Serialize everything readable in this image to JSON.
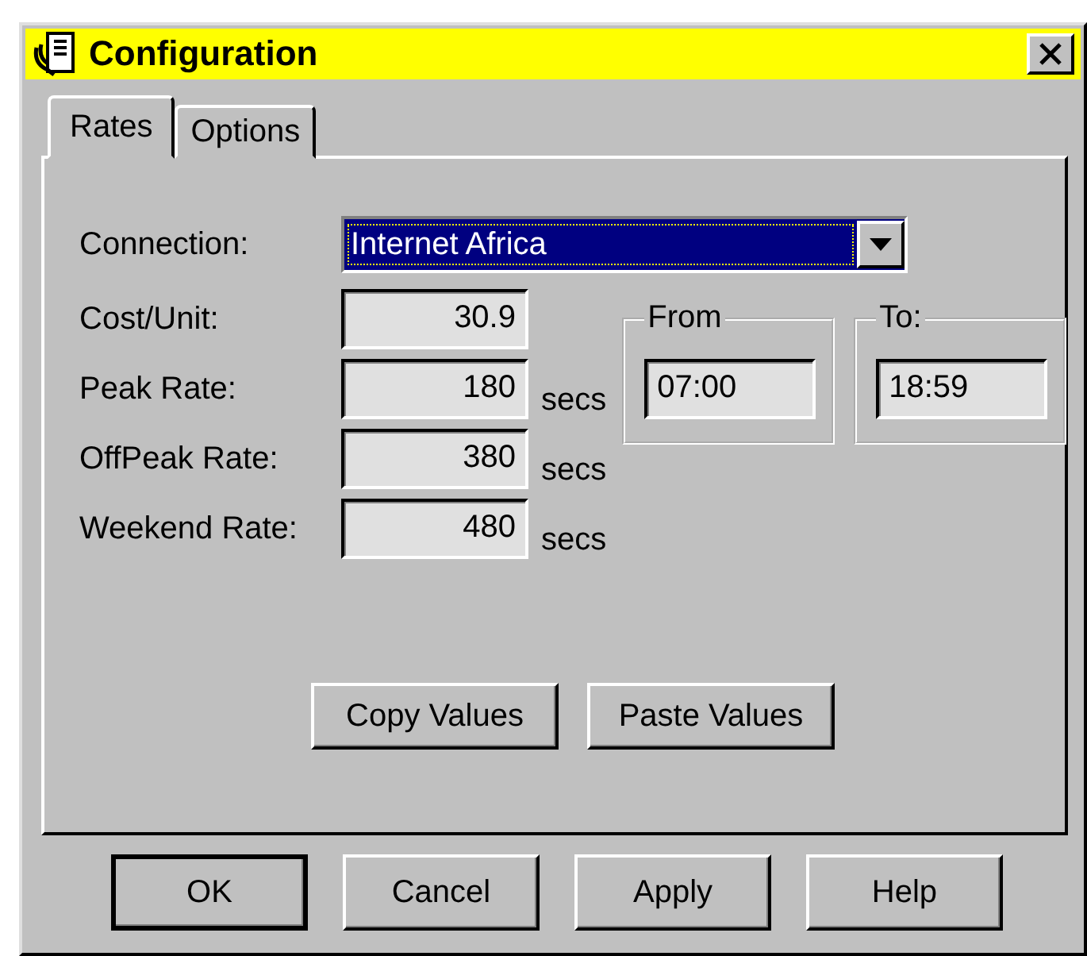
{
  "window": {
    "title": "Configuration"
  },
  "tabs": [
    {
      "label": "Rates",
      "selected": true
    },
    {
      "label": "Options",
      "selected": false
    }
  ],
  "connection": {
    "label": "Connection:",
    "value": "Internet Africa"
  },
  "rates": [
    {
      "label": "Cost/Unit:",
      "value": "30.9"
    },
    {
      "label": "Peak Rate:",
      "value": "180",
      "unit": "secs"
    },
    {
      "label": "OffPeak Rate:",
      "value": "380",
      "unit": "secs"
    },
    {
      "label": "Weekend Rate:",
      "value": "480",
      "unit": "secs"
    }
  ],
  "time_ranges": [
    {
      "label": "From",
      "value": "07:00"
    },
    {
      "label": "To:",
      "value": "18:59"
    }
  ],
  "panel_buttons": [
    {
      "label": "Copy Values"
    },
    {
      "label": "Paste Values"
    }
  ],
  "dialog_buttons": [
    {
      "label": "OK",
      "default": true
    },
    {
      "label": "Cancel",
      "default": false
    },
    {
      "label": "Apply",
      "default": false
    },
    {
      "label": "Help",
      "default": false
    }
  ]
}
